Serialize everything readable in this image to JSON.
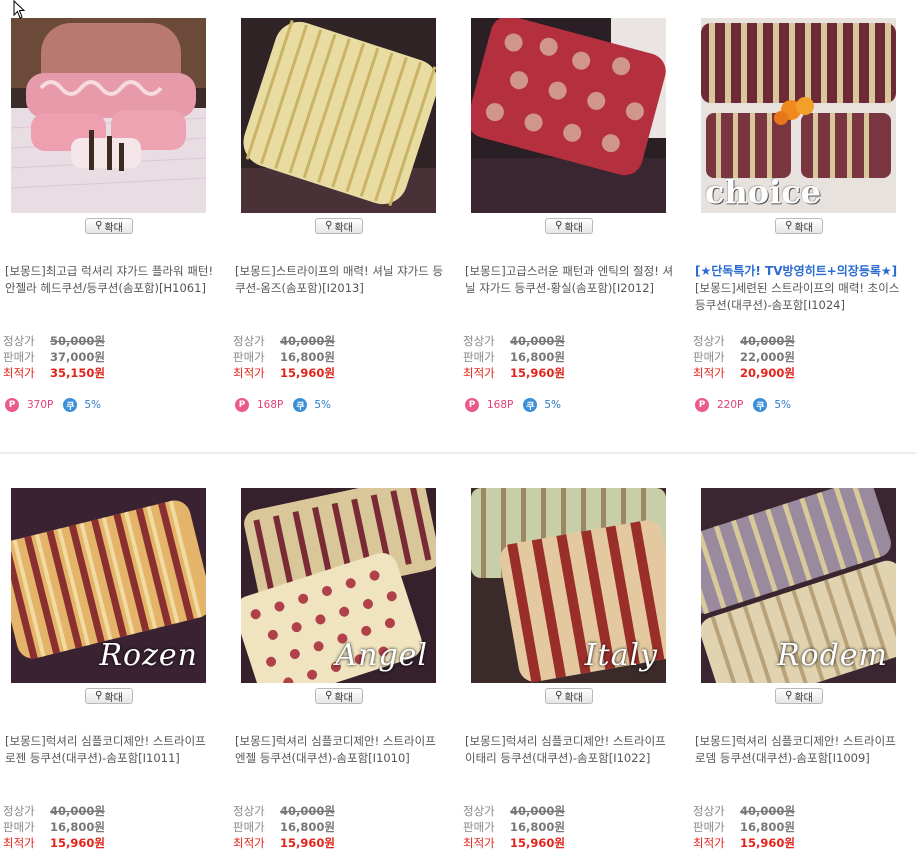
{
  "zoom_label": "확대",
  "price_labels": {
    "list": "정상가",
    "sale": "판매가",
    "best": "최적가"
  },
  "rows": [
    {
      "cards": [
        {
          "hot": "",
          "name": "[보몽드]최고급 럭셔리 쟈가드 플라워 패턴! 안젤라 헤드쿠션/등쿠션(솜포함)[H1061]",
          "list_price": "50,000원",
          "sale_price": "37,000원",
          "best_price": "35,150원",
          "points": "370P",
          "coupon": "5%",
          "overlay": ""
        },
        {
          "hot": "",
          "name": "[보몽드]스트라이프의 매력! 셔닐 쟈가드 등쿠션-옴즈(솜포함)[I2013]",
          "list_price": "40,000원",
          "sale_price": "16,800원",
          "best_price": "15,960원",
          "points": "168P",
          "coupon": "5%",
          "overlay": ""
        },
        {
          "hot": "",
          "name": "[보몽드]고급스러운 패턴과 엔틱의 절정! 셔닐 쟈가드 등쿠션-황실(솜포함)[I2012]",
          "list_price": "40,000원",
          "sale_price": "16,800원",
          "best_price": "15,960원",
          "points": "168P",
          "coupon": "5%",
          "overlay": ""
        },
        {
          "hot": "[★단독특가! TV방영히트+의장등록★]",
          "name": "[보몽드]세련된 스트라이프의 매력! 초이스 등쿠션(대쿠션)-솜포함[I1024]",
          "list_price": "40,000원",
          "sale_price": "22,000원",
          "best_price": "20,900원",
          "points": "220P",
          "coupon": "5%",
          "overlay": "choice"
        }
      ]
    },
    {
      "cards": [
        {
          "hot": "",
          "name": "[보몽드]럭셔리 심플코디제안! 스트라이프 로젠 등쿠션(대쿠션)-솜포함[I1011]",
          "list_price": "40,000원",
          "sale_price": "16,800원",
          "best_price": "15,960원",
          "points": "",
          "coupon": "",
          "overlay": "Rozen"
        },
        {
          "hot": "",
          "name": "[보몽드]럭셔리 심플코디제안! 스트라이프 엔젤 등쿠션(대쿠션)-솜포함[I1010]",
          "list_price": "40,000원",
          "sale_price": "16,800원",
          "best_price": "15,960원",
          "points": "",
          "coupon": "",
          "overlay": "Angel"
        },
        {
          "hot": "",
          "name": "[보몽드]럭셔리 심플코디제안! 스트라이프 이태리 등쿠션(대쿠션)-솜포함[I1022]",
          "list_price": "40,000원",
          "sale_price": "16,800원",
          "best_price": "15,960원",
          "points": "",
          "coupon": "",
          "overlay": "Italy"
        },
        {
          "hot": "",
          "name": "[보몽드]럭셔리 심플코디제안! 스트라이프 로뎀 등쿠션(대쿠션)-솜포함[I1009]",
          "list_price": "40,000원",
          "sale_price": "16,800원",
          "best_price": "15,960원",
          "points": "",
          "coupon": "",
          "overlay": "Rodem"
        }
      ]
    }
  ],
  "colors": {
    "best_price": "#e2231a",
    "hot": "#2a6bd0",
    "point_badge": "#e85a8c",
    "coupon_badge": "#3b8fd6"
  }
}
